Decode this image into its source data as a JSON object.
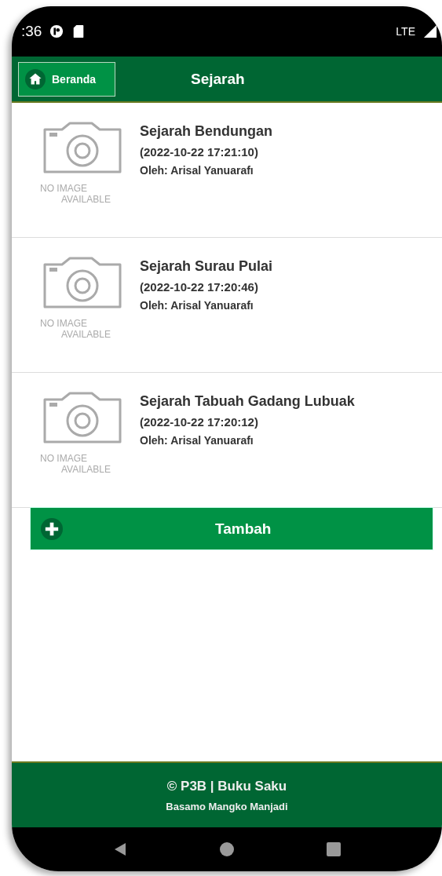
{
  "status_bar": {
    "time": ":36",
    "network": "LTE"
  },
  "header": {
    "home_button": "Beranda",
    "title": "Sejarah"
  },
  "items": [
    {
      "title": "Sejarah Bendungan",
      "date": "(2022-10-22 17:21:10)",
      "author": "Oleh: Arisal Yanuarafı",
      "image_text": [
        "NO IMAGE",
        "AVAILABLE"
      ]
    },
    {
      "title": "Sejarah Surau Pulai",
      "date": "(2022-10-22 17:20:46)",
      "author": "Oleh: Arisal Yanuarafı",
      "image_text": [
        "NO IMAGE",
        "AVAILABLE"
      ]
    },
    {
      "title": "Sejarah Tabuah Gadang Lubuak",
      "date": "(2022-10-22 17:20:12)",
      "author": "Oleh: Arisal Yanuarafı",
      "image_text": [
        "NO IMAGE",
        "AVAILABLE"
      ]
    }
  ],
  "add_button": "Tambah",
  "footer": {
    "line1": "© P3B | Buku Saku",
    "line2": "Basamo Mangko Manjadi"
  }
}
